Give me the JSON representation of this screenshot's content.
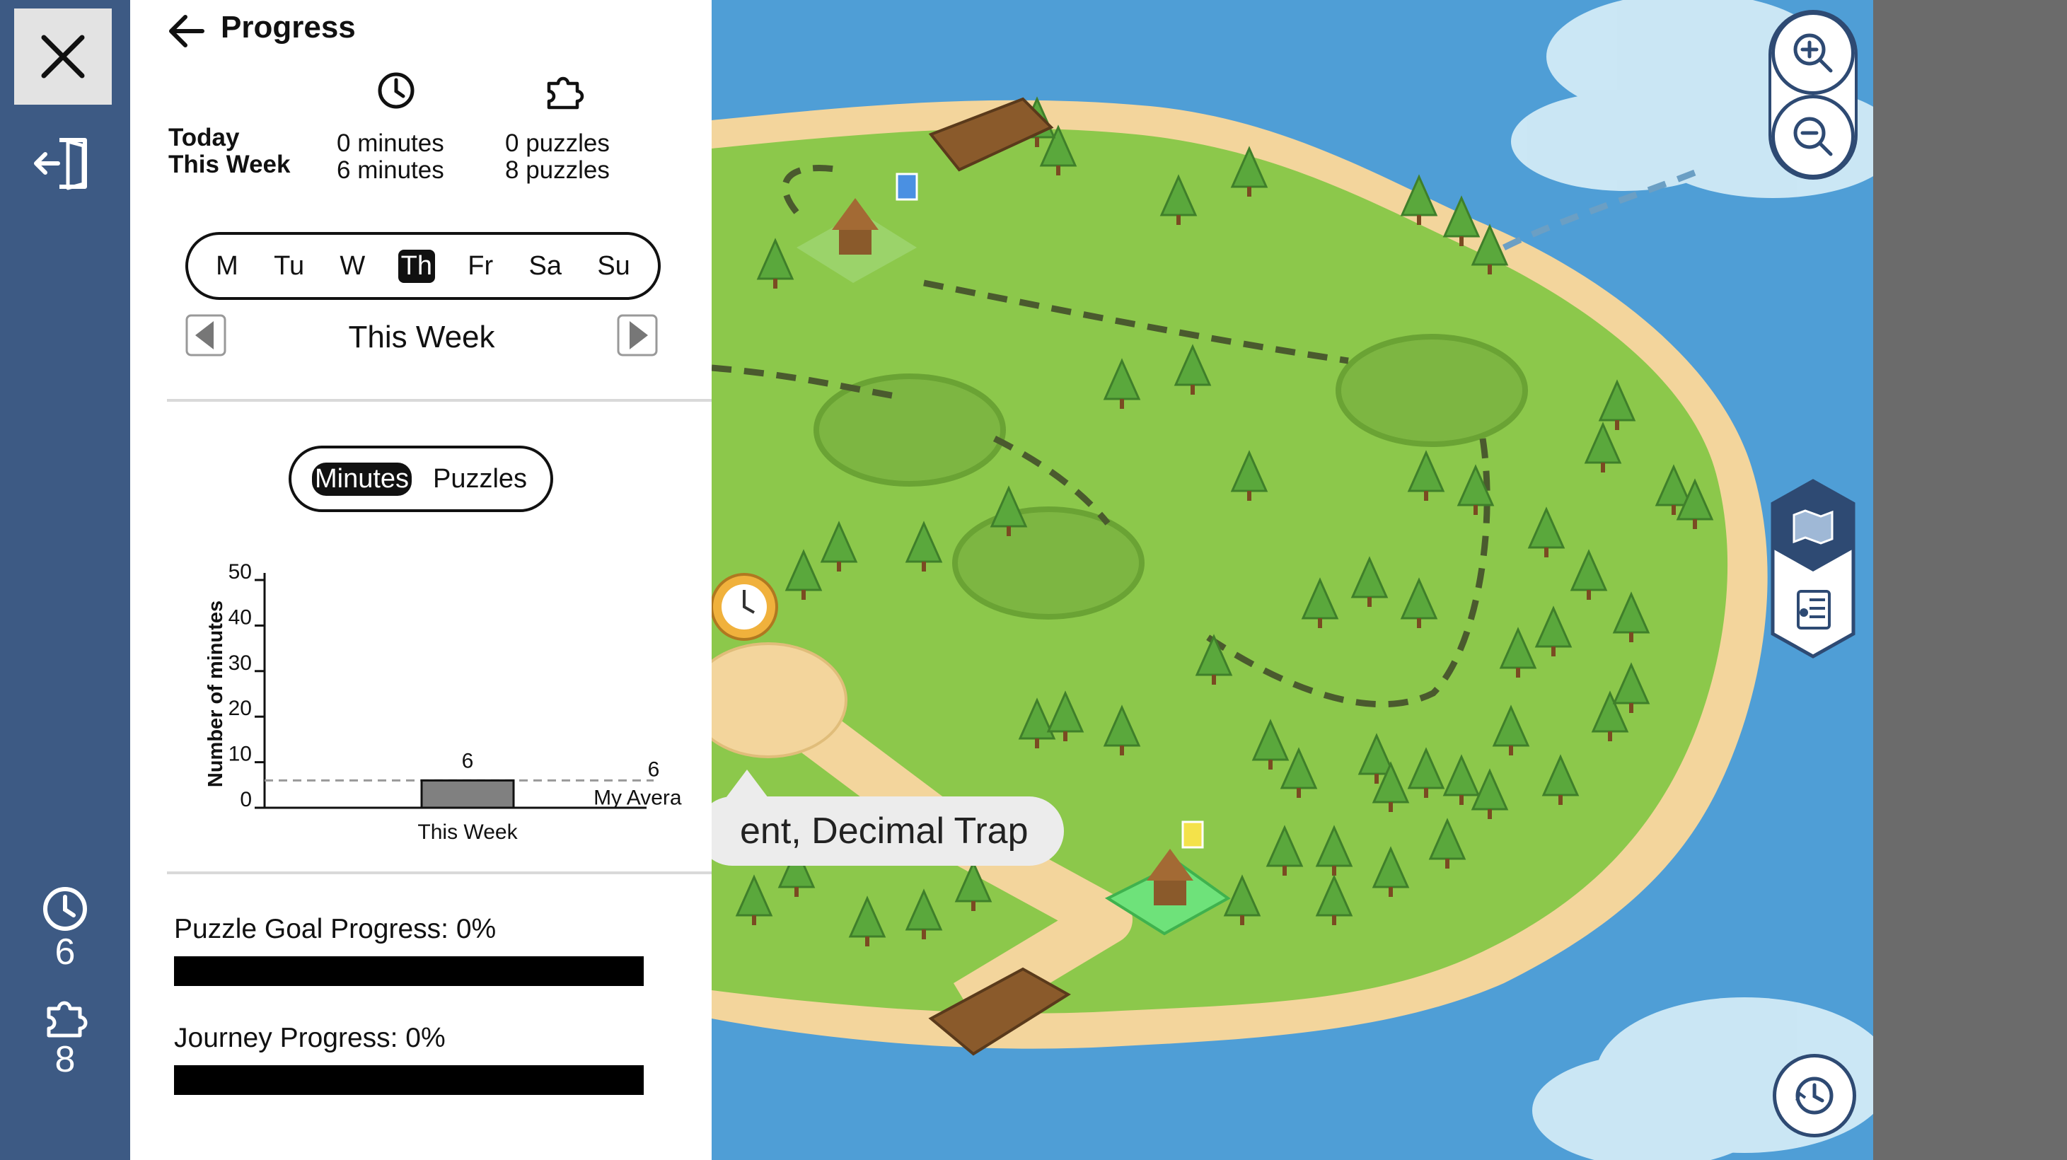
{
  "rail": {
    "close_icon": "close-icon",
    "exit_icon": "exit-door-icon",
    "minutes_icon": "clock-icon",
    "minutes_count": "6",
    "puzzles_icon": "puzzle-icon",
    "puzzles_count": "8"
  },
  "panel": {
    "title": "Progress",
    "stats": {
      "minutes_icon": "clock-icon",
      "puzzles_icon": "puzzle-icon",
      "rows": [
        {
          "label": "Today",
          "minutes": "0 minutes",
          "puzzles": "0 puzzles"
        },
        {
          "label": "This Week",
          "minutes": "6 minutes",
          "puzzles": "8 puzzles"
        }
      ]
    },
    "days": [
      "M",
      "Tu",
      "W",
      "Th",
      "Fr",
      "Sa",
      "Su"
    ],
    "active_day": "Th",
    "week_label": "This Week",
    "modes": [
      "Minutes",
      "Puzzles"
    ],
    "active_mode": "Minutes",
    "goals": [
      {
        "label": "Puzzle Goal Progress: 0%",
        "value": 0
      },
      {
        "label": "Journey Progress: 0%",
        "value": 0
      }
    ]
  },
  "chart_data": {
    "type": "bar",
    "categories": [
      "This Week"
    ],
    "values": [
      6
    ],
    "data_labels": [
      "6"
    ],
    "ylabel": "Number of minutes",
    "ylim": [
      0,
      50
    ],
    "yticks": [
      "0",
      "10",
      "20",
      "30",
      "40",
      "50"
    ],
    "reference_line": {
      "label": "My Average",
      "value": 6,
      "value_label": "6",
      "style": "dashed"
    },
    "grid": false,
    "bar_color": "#808080"
  },
  "map": {
    "callout_text": "ent, Decimal Trap",
    "zoom_in_icon": "zoom-in-icon",
    "zoom_out_icon": "zoom-out-icon",
    "map_view_icon": "map-icon",
    "list_view_icon": "list-icon",
    "history_icon": "clock-history-icon",
    "water_color": "#4f9ed6",
    "land_color": "#8cc84b",
    "sand_color": "#f3d59c"
  }
}
